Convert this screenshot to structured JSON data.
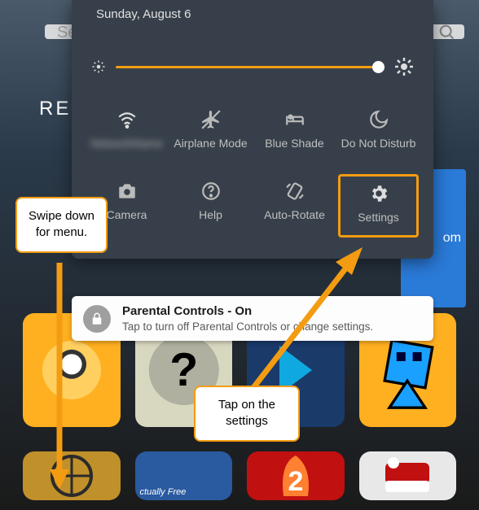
{
  "colors": {
    "accent": "#f39c12",
    "panel": "#37404a",
    "bar": "#fdfdfd"
  },
  "background": {
    "search_truncated": "Se",
    "recent_label": "REC",
    "blue_tile_text": "om"
  },
  "panel": {
    "date": "Sunday, August 6",
    "brightness": {
      "min_icon": "brightness-low-icon",
      "max_icon": "brightness-high-icon",
      "value_pct": 100
    },
    "row1": [
      {
        "id": "wifi",
        "icon": "wifi-icon",
        "label": "NetworkName"
      },
      {
        "id": "airplane",
        "icon": "airplane-icon",
        "label": "Airplane Mode"
      },
      {
        "id": "blue-shade",
        "icon": "bed-icon",
        "label": "Blue Shade"
      },
      {
        "id": "dnd",
        "icon": "moon-icon",
        "label": "Do Not Disturb"
      }
    ],
    "row2": [
      {
        "id": "camera",
        "icon": "camera-icon",
        "label": "Camera"
      },
      {
        "id": "help",
        "icon": "help-icon",
        "label": "Help"
      },
      {
        "id": "autorotate",
        "icon": "rotate-icon",
        "label": "Auto-Rotate"
      },
      {
        "id": "settings",
        "icon": "gear-icon",
        "label": "Settings",
        "highlighted": true
      }
    ]
  },
  "parental": {
    "icon": "lock-icon",
    "title": "Parental Controls - On",
    "subtitle": "Tap to turn off Parental Controls or change settings."
  },
  "callouts": {
    "swipe": "Swipe down for menu.",
    "settings": "Tap on the settings"
  }
}
